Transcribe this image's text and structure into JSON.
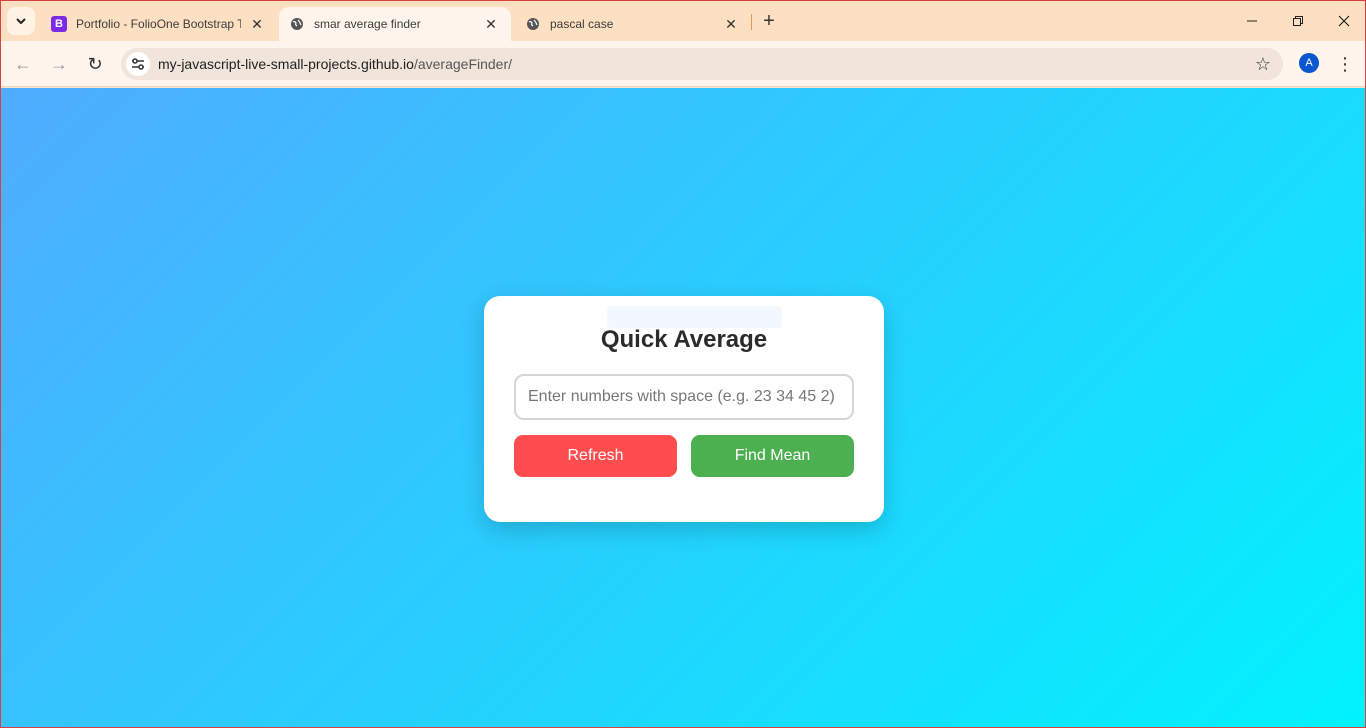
{
  "browser": {
    "tabs": [
      {
        "title": "Portfolio - FolioOne Bootstrap T",
        "favicon": "bootstrap-b-icon",
        "active": false
      },
      {
        "title": "smar average finder",
        "favicon": "globe-icon",
        "active": true
      },
      {
        "title": "pascal case",
        "favicon": "globe-icon",
        "active": false
      }
    ],
    "favicon_letter": "B",
    "url_domain": "my-javascript-live-small-projects.github.io",
    "url_path": "/averageFinder/",
    "profile_initial": "A"
  },
  "page": {
    "title": "Quick Average",
    "input_placeholder": "Enter numbers with space (e.g. 23 34 45 2)",
    "input_value": "",
    "refresh_label": "Refresh",
    "find_mean_label": "Find Mean",
    "colors": {
      "gradient_start": "#4facfe",
      "gradient_end": "#00f2fe",
      "refresh_button": "#ff4d4f",
      "find_mean_button": "#4caf50"
    }
  }
}
